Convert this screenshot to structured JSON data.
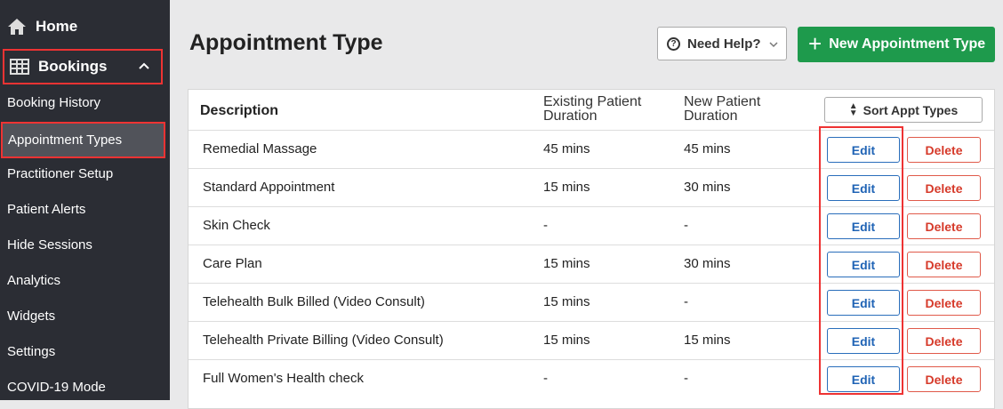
{
  "sidebar": {
    "home_label": "Home",
    "bookings_label": "Bookings",
    "items": [
      {
        "label": "Booking History"
      },
      {
        "label": "Appointment Types"
      },
      {
        "label": "Practitioner Setup"
      },
      {
        "label": "Patient Alerts"
      },
      {
        "label": "Hide Sessions"
      },
      {
        "label": "Analytics"
      },
      {
        "label": "Widgets"
      },
      {
        "label": "Settings"
      },
      {
        "label": "COVID-19 Mode"
      }
    ]
  },
  "header": {
    "title": "Appointment Type",
    "help_label": "Need Help?",
    "new_label": "New Appointment Type"
  },
  "table": {
    "col_desc": "Description",
    "col_exist_1": "Existing Patient",
    "col_exist_2": "Duration",
    "col_new_1": "New Patient",
    "col_new_2": "Duration",
    "sort_label": "Sort Appt Types",
    "edit_label": "Edit",
    "delete_label": "Delete",
    "rows": [
      {
        "desc": "Remedial Massage",
        "existing": "45 mins",
        "new": "45 mins"
      },
      {
        "desc": "Standard Appointment",
        "existing": "15 mins",
        "new": "30 mins"
      },
      {
        "desc": "Skin Check",
        "existing": "-",
        "new": "-"
      },
      {
        "desc": "Care Plan",
        "existing": "15 mins",
        "new": "30 mins"
      },
      {
        "desc": "Telehealth Bulk Billed (Video Consult)",
        "existing": "15 mins",
        "new": "-"
      },
      {
        "desc": "Telehealth Private Billing (Video Consult)",
        "existing": "15 mins",
        "new": "15 mins"
      },
      {
        "desc": "Full Women's Health check",
        "existing": "-",
        "new": "-"
      }
    ]
  },
  "colors": {
    "sidebar_bg": "#2b2d34",
    "accent_green": "#1e9a4c",
    "edit_blue": "#1f63b5",
    "delete_red": "#d63a2a",
    "highlight_red": "#e33333"
  }
}
